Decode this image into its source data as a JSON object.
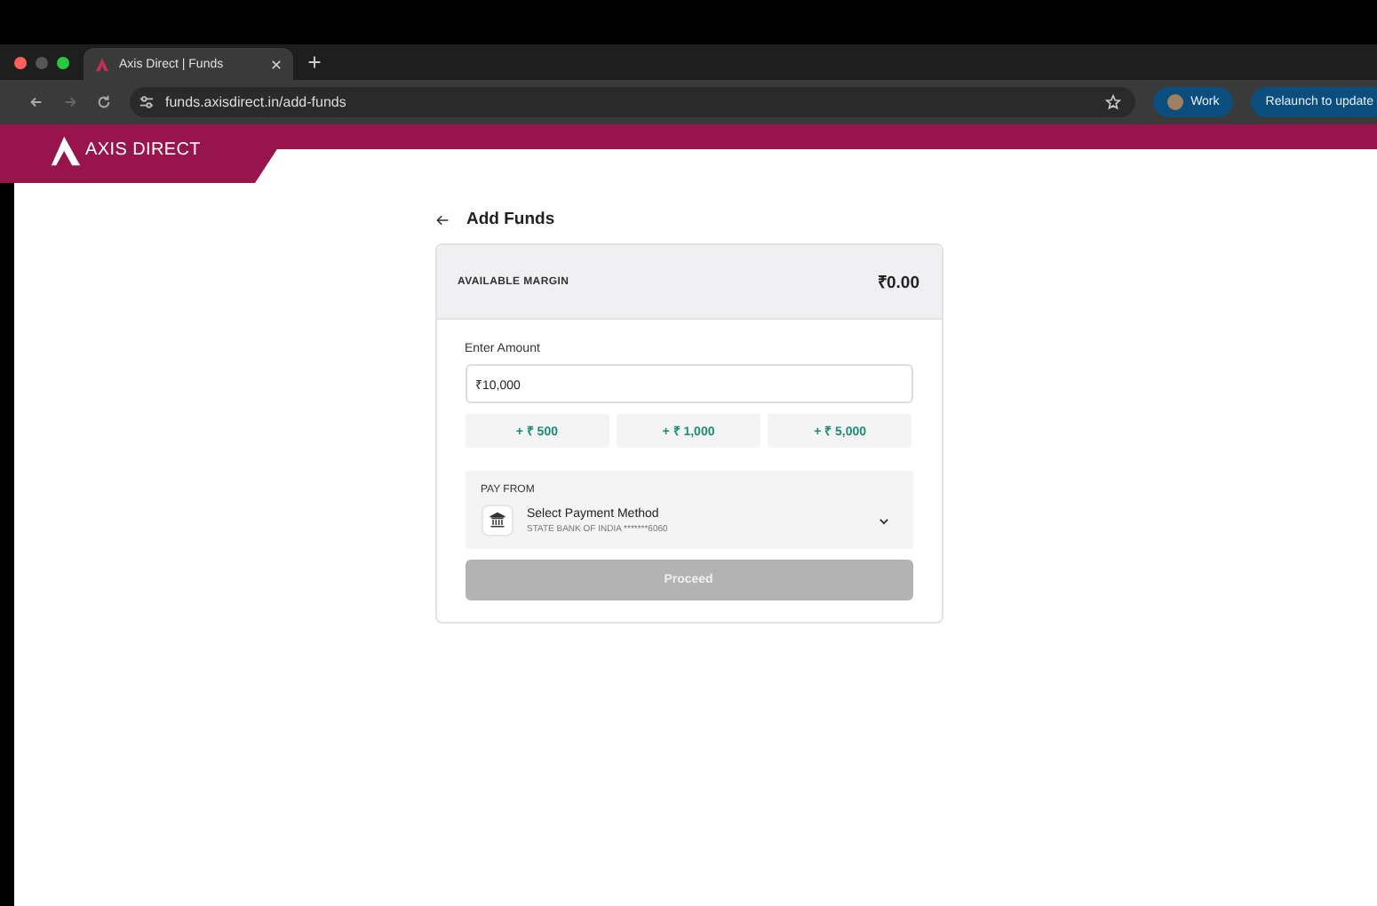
{
  "browser": {
    "tab_title": "Axis Direct | Funds",
    "url": "funds.axisdirect.in/add-funds",
    "profile": "Work",
    "update_button": "Relaunch to update"
  },
  "header": {
    "logo_text": "AXIS DIRECT"
  },
  "page": {
    "title": "Add Funds"
  },
  "margin": {
    "label": "AVAILABLE MARGIN",
    "value": "₹0.00"
  },
  "amount": {
    "label": "Enter Amount",
    "value": "₹10,000"
  },
  "quick_add": [
    "+ ₹ 500",
    "+ ₹ 1,000",
    "+ ₹ 5,000"
  ],
  "pay_from": {
    "label": "PAY FROM",
    "method": "Select Payment Method",
    "account": "STATE BANK OF INDIA *******6060"
  },
  "proceed": {
    "label": "Proceed",
    "disabled": true
  }
}
